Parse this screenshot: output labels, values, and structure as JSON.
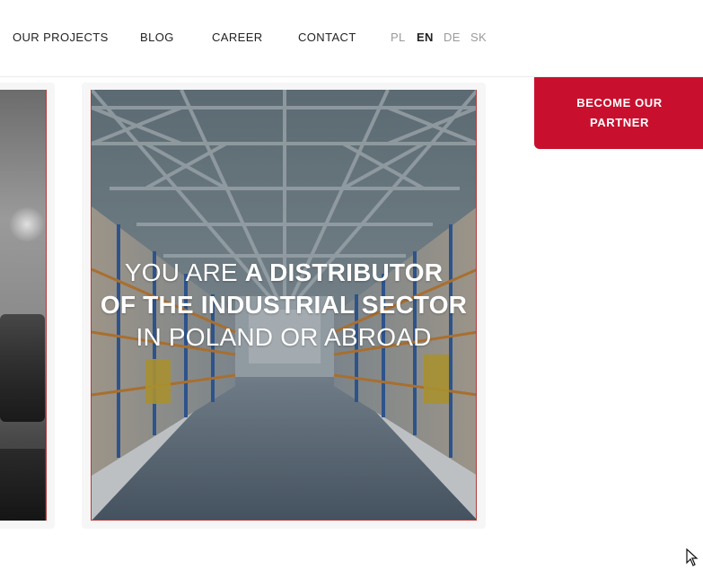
{
  "nav": {
    "items": [
      {
        "label": "OUR PROJECTS"
      },
      {
        "label": "BLOG"
      },
      {
        "label": "CAREER"
      },
      {
        "label": "CONTACT"
      }
    ],
    "languages": [
      {
        "code": "PL",
        "active": false
      },
      {
        "code": "EN",
        "active": true
      },
      {
        "code": "DE",
        "active": false
      },
      {
        "code": "SK",
        "active": false
      }
    ]
  },
  "cta": {
    "label": "BECOME OUR PARTNER",
    "color": "#c8102e"
  },
  "card": {
    "headline_line1_light": "YOU ARE ",
    "headline_line1_bold": "A DISTRIBUTOR",
    "headline_line2_bold": "OF THE INDUSTRIAL SECTOR",
    "headline_line3_light": "IN POLAND OR ABROAD",
    "image": "warehouse-interior"
  },
  "colors": {
    "accent": "#c8102e",
    "text": "#222222",
    "muted": "#9a9a9a"
  }
}
